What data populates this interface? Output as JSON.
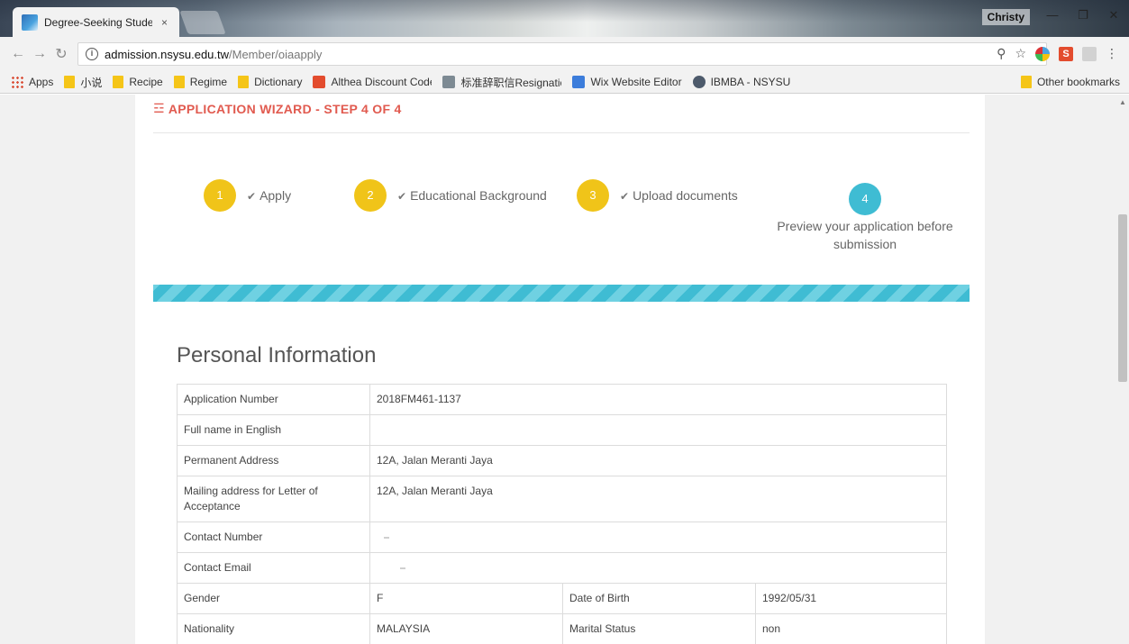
{
  "browser": {
    "tab_title": "Degree-Seeking Student",
    "tab_close": "×",
    "user": "Christy",
    "url_host": "admission.nsysu.edu.tw",
    "url_path": "/Member/oiaapply",
    "info_glyph": "i",
    "bookmarks": [
      {
        "label": "Apps",
        "icon": "apps-grid-icon"
      },
      {
        "label": "小说",
        "icon": "folder-icon"
      },
      {
        "label": "Recipe",
        "icon": "folder-icon"
      },
      {
        "label": "Regime",
        "icon": "folder-icon"
      },
      {
        "label": "Dictionary",
        "icon": "folder-icon"
      },
      {
        "label": "Althea Discount Code",
        "icon": "althea-icon",
        "color": "#e34c2e"
      },
      {
        "label": "标准辞职信Resignatio",
        "icon": "page-icon",
        "color": "#7d8a93"
      },
      {
        "label": "Wix Website Editor",
        "icon": "wix-icon",
        "color": "#3c7ddb"
      },
      {
        "label": "IBMBA - NSYSU",
        "icon": "globe-icon",
        "color": "#4d5a6b"
      }
    ],
    "other_bookmarks": "Other bookmarks"
  },
  "wizard": {
    "title": "APPLICATION WIZARD - STEP 4 OF 4",
    "steps": [
      {
        "number": "1",
        "label": "Apply",
        "status": "done"
      },
      {
        "number": "2",
        "label": "Educational Background",
        "status": "done"
      },
      {
        "number": "3",
        "label": "Upload documents",
        "status": "done"
      },
      {
        "number": "4",
        "label": "Preview your application before submission",
        "status": "active"
      }
    ],
    "progress_fraction": 1.0
  },
  "personal_info": {
    "heading": "Personal Information",
    "rows": {
      "application_number": {
        "label": "Application Number",
        "value": "2018FM461-1137"
      },
      "full_name": {
        "label": "Full name in English",
        "value": ""
      },
      "permanent_address": {
        "label": "Permanent Address",
        "value": "12A, Jalan Meranti Jaya"
      },
      "mailing_address": {
        "label": "Mailing address for Letter of Acceptance",
        "value": "12A, Jalan Meranti Jaya"
      },
      "contact_number": {
        "label": "Contact Number",
        "value": ""
      },
      "contact_email": {
        "label": "Contact Email",
        "value": ""
      },
      "gender": {
        "label": "Gender",
        "value": "F"
      },
      "date_of_birth": {
        "label": "Date of Birth",
        "value": "1992/05/31"
      },
      "nationality": {
        "label": "Nationality",
        "value": "MALAYSIA"
      },
      "marital_status": {
        "label": "Marital Status",
        "value": "non"
      }
    }
  },
  "colors": {
    "accent_red": "#e15a4f",
    "step_done": "#f0c419",
    "step_active": "#3fbcd3"
  }
}
